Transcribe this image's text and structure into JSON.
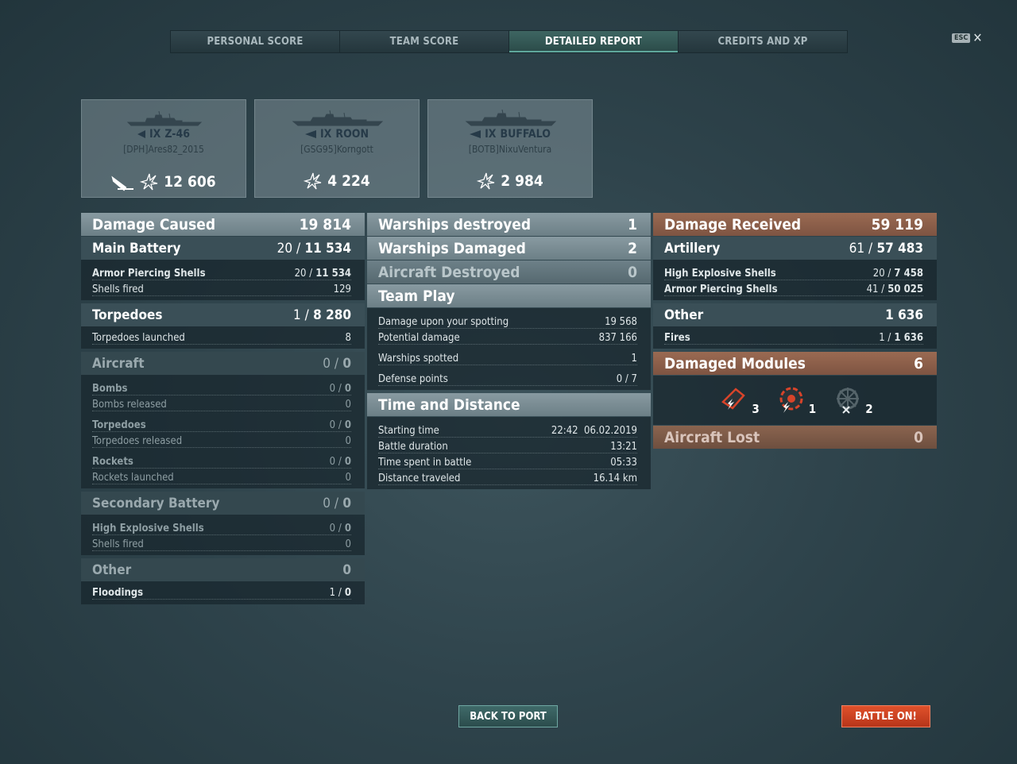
{
  "tabs": [
    {
      "label": "PERSONAL SCORE"
    },
    {
      "label": "TEAM SCORE"
    },
    {
      "label": "DETAILED REPORT"
    },
    {
      "label": "CREDITS AND XP"
    }
  ],
  "esc": {
    "key": "ESC",
    "close": "✕"
  },
  "ships": [
    {
      "tier": "IX",
      "name": "Z-46",
      "player": "[DPH]Ares82_2015",
      "score": "12 606",
      "class": "destroyer"
    },
    {
      "tier": "IX",
      "name": "ROON",
      "player": "[GSG95]Korngott",
      "score": "4 224",
      "class": "cruiser"
    },
    {
      "tier": "IX",
      "name": "BUFFALO",
      "player": "[BOTB]NixuVentura",
      "score": "2 984",
      "class": "cruiser"
    }
  ],
  "damage_caused": {
    "label": "Damage Caused",
    "value": "19 814",
    "main_battery": {
      "label": "Main Battery",
      "hits": "20 /",
      "value": "11 534",
      "ap": {
        "label": "Armor Piercing Shells",
        "hits": "20 /",
        "value": "11 534"
      },
      "fired": {
        "label": "Shells fired",
        "value": "129"
      }
    },
    "torpedoes": {
      "label": "Torpedoes",
      "hits": "1 /",
      "value": "8 280",
      "launched": {
        "label": "Torpedoes launched",
        "value": "8"
      }
    },
    "aircraft": {
      "label": "Aircraft",
      "hits": "0 /",
      "value": "0",
      "bombs": {
        "label": "Bombs",
        "hits": "0 /",
        "value": "0"
      },
      "bombs_released": {
        "label": "Bombs released",
        "value": "0"
      },
      "torpedoes": {
        "label": "Torpedoes",
        "hits": "0 /",
        "value": "0"
      },
      "torpedoes_released": {
        "label": "Torpedoes released",
        "value": "0"
      },
      "rockets": {
        "label": "Rockets",
        "hits": "0 /",
        "value": "0"
      },
      "rockets_launched": {
        "label": "Rockets launched",
        "value": "0"
      }
    },
    "secondary": {
      "label": "Secondary Battery",
      "hits": "0 /",
      "value": "0",
      "he": {
        "label": "High Explosive Shells",
        "hits": "0 /",
        "value": "0"
      },
      "fired": {
        "label": "Shells fired",
        "value": "0"
      }
    },
    "other": {
      "label": "Other",
      "value": "0",
      "floodings": {
        "label": "Floodings",
        "hits": "1 /",
        "value": "0"
      }
    }
  },
  "mid": {
    "destroyed": {
      "label": "Warships destroyed",
      "value": "1"
    },
    "damaged": {
      "label": "Warships Damaged",
      "value": "2"
    },
    "aircraft": {
      "label": "Aircraft Destroyed",
      "value": "0"
    },
    "team_play": {
      "label": "Team Play",
      "spotting": {
        "label": "Damage upon your spotting",
        "value": "19 568"
      },
      "potential": {
        "label": "Potential damage",
        "value": "837 166"
      },
      "spotted": {
        "label": "Warships spotted",
        "value": "1"
      },
      "defense": {
        "label": "Defense points",
        "value": "0 / 7"
      }
    },
    "time": {
      "label": "Time and Distance",
      "start": {
        "label": "Starting time",
        "value": "22:42  06.02.2019"
      },
      "duration": {
        "label": "Battle duration",
        "value": "13:21"
      },
      "spent": {
        "label": "Time spent in battle",
        "value": "05:33"
      },
      "distance": {
        "label": "Distance traveled",
        "value": "16.14 km"
      }
    }
  },
  "damage_received": {
    "label": "Damage Received",
    "value": "59 119",
    "artillery": {
      "label": "Artillery",
      "hits": "61 /",
      "value": "57 483",
      "he": {
        "label": "High Explosive Shells",
        "hits": "20 /",
        "value": "7 458"
      },
      "ap": {
        "label": "Armor Piercing Shells",
        "hits": "41 /",
        "value": "50 025"
      }
    },
    "other": {
      "label": "Other",
      "value": "1 636",
      "fires": {
        "label": "Fires",
        "hits": "1 /",
        "value": "1 636"
      }
    },
    "modules": {
      "label": "Damaged Modules",
      "value": "6",
      "items": [
        {
          "name": "turret",
          "count": "3"
        },
        {
          "name": "engine",
          "count": "1"
        },
        {
          "name": "steering",
          "count": "2"
        }
      ]
    },
    "aircraft_lost": {
      "label": "Aircraft Lost",
      "value": "0"
    }
  },
  "buttons": {
    "back": "BACK TO PORT",
    "battle": "BATTLE ON!"
  }
}
